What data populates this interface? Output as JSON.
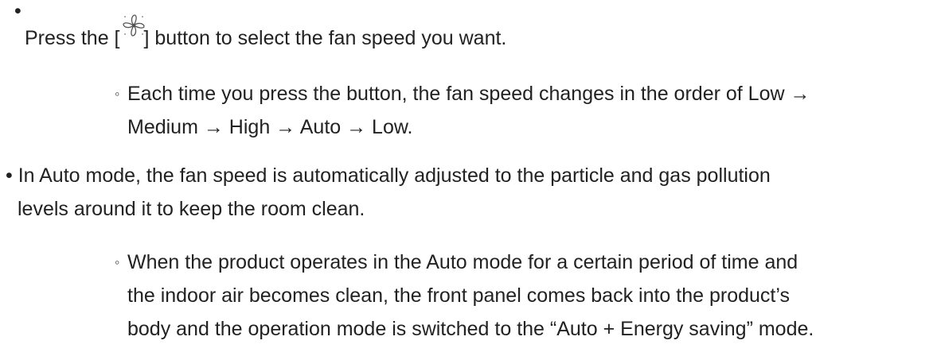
{
  "items": [
    {
      "bullet": "•",
      "text_before": "Press the [",
      "icon": "fan-icon",
      "text_after": "] button to select the fan speed you want."
    },
    {
      "bullet": "◦",
      "lines": [
        "Each time you press the button, the fan speed changes in the order of Low →",
        "Medium → High → Auto → Low."
      ]
    },
    {
      "bullet": "•",
      "lines": [
        "In Auto mode, the fan speed is automatically adjusted to the particle and gas pollution",
        "levels around it to keep the room clean."
      ]
    },
    {
      "bullet": "◦",
      "lines": [
        "When the product operates in the Auto mode for a certain period of time and",
        "the indoor air becomes clean, the front panel comes back into the product’s",
        "body and the operation mode is switched to the “Auto + Energy saving” mode."
      ]
    }
  ]
}
